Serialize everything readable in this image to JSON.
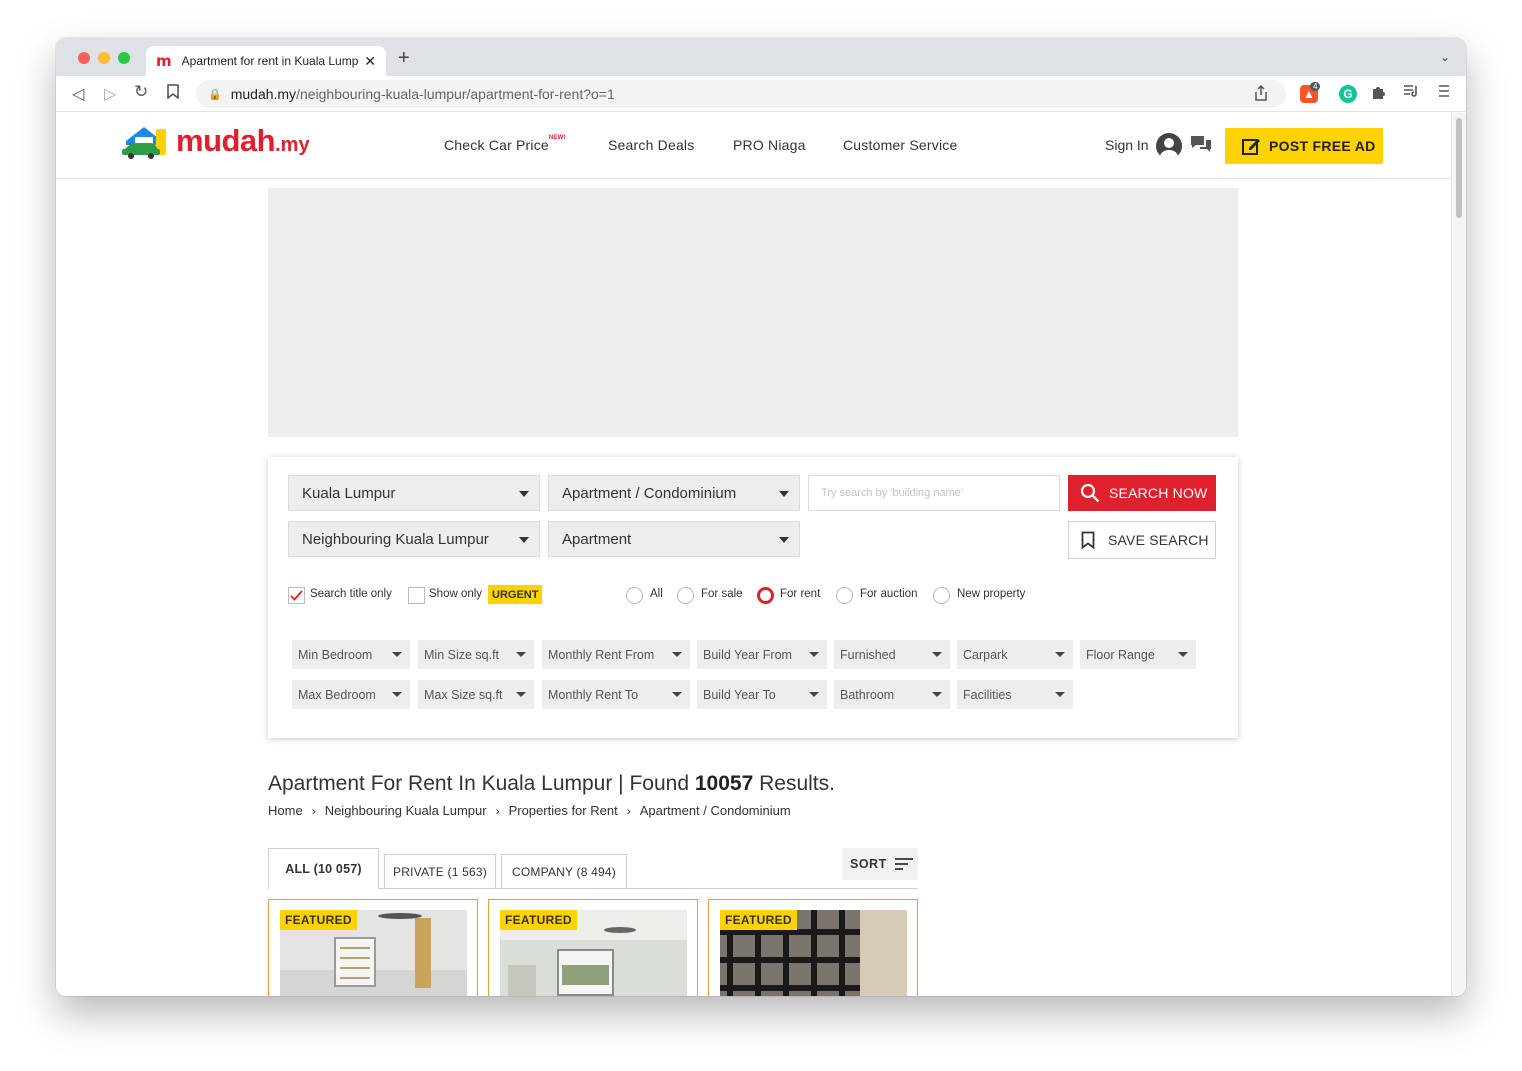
{
  "browser": {
    "tab_title": "Apartment for rent in Kuala Lumpur",
    "tab_favicon": "m",
    "url_host": "mudah.my",
    "url_path": "/neighbouring-kuala-lumpur/apartment-for-rent?o=1",
    "extension_badge": "4"
  },
  "header": {
    "logo_word": "mudah",
    "logo_tld": ".my",
    "nav": [
      {
        "label": "Check Car Price",
        "badge": "NEW!"
      },
      {
        "label": "Search Deals"
      },
      {
        "label": "PRO Niaga"
      },
      {
        "label": "Customer Service"
      }
    ],
    "sign_in": "Sign In",
    "post_ad": "POST FREE AD"
  },
  "search": {
    "region": "Kuala Lumpur",
    "area": "Neighbouring Kuala Lumpur",
    "category": "Apartment / Condominium",
    "subcategory": "Apartment",
    "keyword_placeholder": "Try search by 'building name'",
    "search_button": "SEARCH NOW",
    "save_button": "SAVE SEARCH",
    "search_title_only": "Search title only",
    "show_only": "Show only",
    "urgent": "URGENT",
    "types": [
      "All",
      "For sale",
      "For rent",
      "For auction",
      "New property"
    ],
    "selected_type": "For rent",
    "filters_row1": [
      "Min Bedroom",
      "Min Size sq.ft",
      "Monthly Rent From",
      "Build Year From",
      "Furnished",
      "Carpark",
      "Floor Range"
    ],
    "filters_row2": [
      "Max Bedroom",
      "Max Size sq.ft",
      "Monthly Rent To",
      "Build Year To",
      "Bathroom",
      "Facilities"
    ]
  },
  "results": {
    "title_prefix": "Apartment For Rent In Kuala Lumpur | Found",
    "count": "10057",
    "title_suffix": "Results.",
    "breadcrumb": [
      "Home",
      "Neighbouring Kuala Lumpur",
      "Properties for Rent",
      "Apartment / Condominium"
    ],
    "tabs": [
      "ALL (10 057)",
      "PRIVATE (1 563)",
      "COMPANY (8 494)"
    ],
    "sort": "SORT",
    "featured_label": "FEATURED"
  },
  "colors": {
    "brand_red": "#e0202c",
    "brand_yellow": "#ffd200",
    "featured_border": "#f09a38"
  }
}
